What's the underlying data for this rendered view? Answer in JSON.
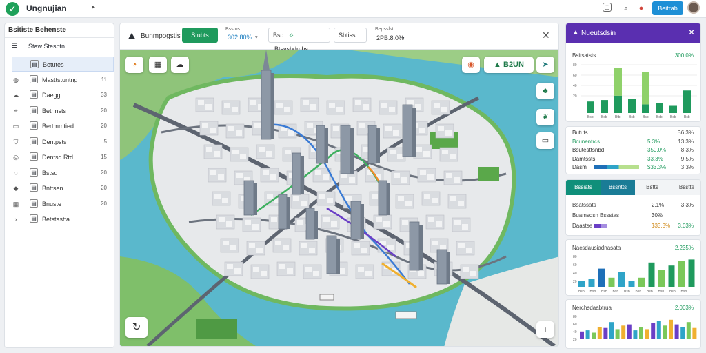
{
  "app": {
    "title": "Ungnujian"
  },
  "topbar": {
    "action_label": "Beitrab"
  },
  "sidebar": {
    "title": "Bsitiste Behenste",
    "top_item": "Staw Stesptn",
    "items": [
      {
        "label": "Betutes",
        "count": "",
        "icon": "doc-icon",
        "active": true
      },
      {
        "label": "Masttstuntng",
        "count": "11",
        "icon": "globe-icon"
      },
      {
        "label": "Daegg",
        "count": "33",
        "icon": "cloud-icon"
      },
      {
        "label": "Betnnsts",
        "count": "20",
        "icon": "pin-icon"
      },
      {
        "label": "Bertmmtied",
        "count": "20",
        "icon": "card-icon"
      },
      {
        "label": "Dentpsts",
        "count": "5",
        "icon": "shield-icon"
      },
      {
        "label": "Dentsd Rtd",
        "count": "15",
        "icon": "ring-icon"
      },
      {
        "label": "Bstsd",
        "count": "20",
        "icon": "chat-icon"
      },
      {
        "label": "Bnttsen",
        "count": "20",
        "icon": "brand-icon"
      },
      {
        "label": "Bnuste",
        "count": "20",
        "icon": "grid-icon"
      },
      {
        "label": "Betstastta",
        "count": "",
        "icon": "chevron-right-icon"
      }
    ]
  },
  "map_toolbar": {
    "title": "Bunmpogstis",
    "green_button": "Stubts",
    "field1_label": "Bsstos",
    "field1_value": "302.80%",
    "field2_prefix": "Bsc",
    "field2_value": "Btsvsbdmbs",
    "field3_value": "Sbtiss",
    "field4_label": "Bepsslst",
    "field4_value": "2PB.8.0%"
  },
  "map": {
    "badge_text": "B2UN",
    "accent": "#1f9a5d",
    "water": "#4fb3c8"
  },
  "panel1": {
    "title": "Nueutsdsin",
    "subtitle": "Bsitsatsts",
    "value": "300.0%",
    "ylabels": [
      "80",
      "60",
      "40",
      "20"
    ],
    "bars": [
      {
        "a": 0.4,
        "b": 0.0
      },
      {
        "a": 0.45,
        "b": 0.0
      },
      {
        "a": 0.6,
        "b": 0.93
      },
      {
        "a": 0.5,
        "b": 0.0
      },
      {
        "a": 0.3,
        "b": 0.85
      },
      {
        "a": 0.35,
        "b": 0.0
      },
      {
        "a": 0.25,
        "b": 0.0
      },
      {
        "a": 0.78,
        "b": 0.0
      }
    ],
    "xlabels": [
      "Bsb",
      "Bsb",
      "Btb",
      "Bsb",
      "Bsb",
      "Bsb",
      "Bsb",
      "Bsb"
    ]
  },
  "panel2": {
    "rows": [
      {
        "label": "Bututs",
        "v1": "",
        "v2": "B6.3%"
      },
      {
        "label": "Bcunentrcs",
        "v1": "5.3%",
        "v2": "13.3%"
      },
      {
        "label": "Bsutesttsnbd",
        "v1": "350.0%",
        "v2": "8.3%"
      },
      {
        "label": "Damtssts",
        "v1": "33.3%",
        "v2": "9.5%"
      },
      {
        "label": "Dasm",
        "v1": "$33.3%",
        "v2": "3.3%"
      }
    ]
  },
  "panel3": {
    "tabs": [
      "Bssiats",
      "Bssntts",
      "Bstts",
      "Bsstte"
    ],
    "rows": [
      {
        "label": "Bsatssats",
        "v1": "2.1%",
        "v2": "3.3%"
      },
      {
        "label": "Buamsdsn Bssstas",
        "v1": "30%",
        "v2": ""
      },
      {
        "label": "Daastse",
        "v1": "$33.3%",
        "v2": "3.03%"
      }
    ]
  },
  "panel4": {
    "title": "Nacsdausiadnasata",
    "value": "2.235%",
    "ylabels": [
      "80",
      "60",
      "40",
      "20"
    ],
    "bars": [
      0.2,
      0.25,
      0.6,
      0.3,
      0.5,
      0.2,
      0.3,
      0.8,
      0.55,
      0.7,
      0.85,
      0.9
    ],
    "xlabels": [
      "Bsb",
      "Bsb",
      "Bsb",
      "Bsb",
      "Bsb",
      "Bsb",
      "Bsb",
      "Bsb",
      "Bsb",
      "Bsb"
    ]
  },
  "panel5": {
    "title": "Nerchsdaabtrua",
    "value": "2.003%",
    "ylabels": [
      "80",
      "60",
      "40",
      "20"
    ],
    "bars": [
      0.3,
      0.35,
      0.25,
      0.5,
      0.45,
      0.7,
      0.4,
      0.55,
      0.6,
      0.35,
      0.5,
      0.4,
      0.65,
      0.75,
      0.55,
      0.8,
      0.6,
      0.5,
      0.7,
      0.45
    ],
    "colors": [
      "#6a3fc6",
      "#2fa4c8",
      "#7bc85a",
      "#f0b030"
    ]
  }
}
